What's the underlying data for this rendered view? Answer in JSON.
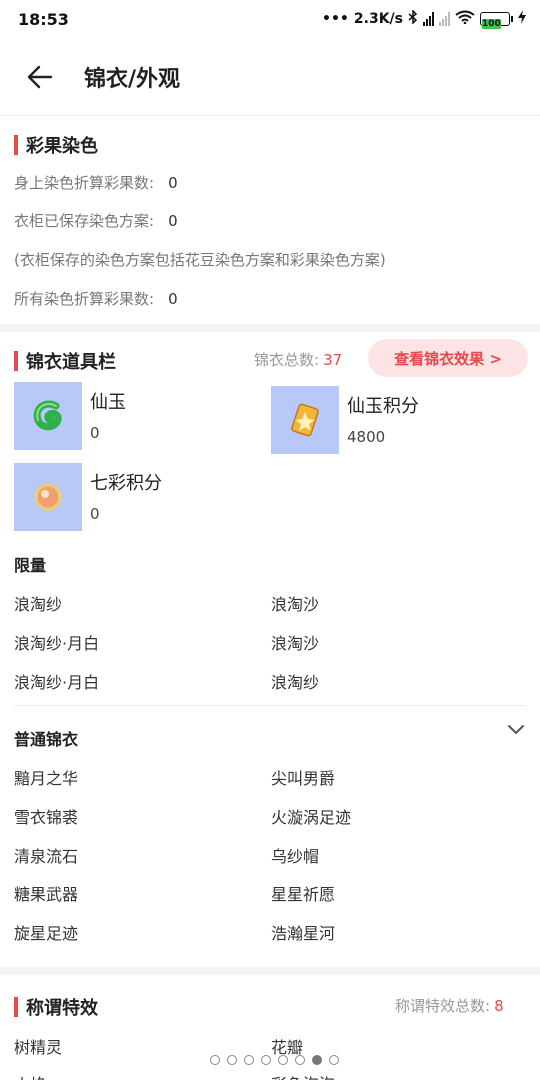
{
  "status": {
    "time": "18:53",
    "speed": "2.3K/s",
    "battery": "100"
  },
  "header": {
    "title": "锦衣/外观"
  },
  "dye": {
    "title": "彩果染色",
    "line1_label": "身上染色折算彩果数:",
    "line1_value": "0",
    "line2_label": "衣柜已保存染色方案:",
    "line2_value": "0",
    "note": "(衣柜保存的染色方案包括花豆染色方案和彩果染色方案)",
    "line3_label": "所有染色折算彩果数:",
    "line3_value": "0"
  },
  "items": {
    "title": "锦衣道具栏",
    "total_label": "锦衣总数:",
    "total_value": "37",
    "view_button": "查看锦衣效果 >",
    "props": [
      {
        "name": "仙玉",
        "count": "0",
        "icon": "jade-icon"
      },
      {
        "name": "仙玉积分",
        "count": "4800",
        "icon": "jade-points-icon"
      },
      {
        "name": "七彩积分",
        "count": "0",
        "icon": "rainbow-points-icon"
      }
    ],
    "limited": {
      "title": "限量",
      "rows": [
        [
          "浪淘纱",
          "浪淘沙"
        ],
        [
          "浪淘纱·月白",
          "浪淘沙"
        ],
        [
          "浪淘纱·月白",
          "浪淘纱"
        ]
      ]
    },
    "normal": {
      "title": "普通锦衣",
      "rows": [
        [
          "黯月之华",
          "尖叫男爵"
        ],
        [
          "雪衣锦裘",
          "火漩涡足迹"
        ],
        [
          "清泉流石",
          "乌纱帽"
        ],
        [
          "糖果武器",
          "星星祈愿"
        ],
        [
          "旋星足迹",
          "浩瀚星河"
        ]
      ]
    }
  },
  "titles": {
    "title": "称谓特效",
    "total_label": "称谓特效总数:",
    "total_value": "8",
    "rows": [
      [
        "树精灵",
        "花瓣"
      ],
      [
        "火焰",
        "彩色泡泡"
      ]
    ]
  },
  "pager": {
    "count": 8,
    "active": 6
  },
  "colors": {
    "accent": "#e8484a",
    "thumb_bg": "#b8c8f8",
    "button_bg": "#fde4e4"
  }
}
